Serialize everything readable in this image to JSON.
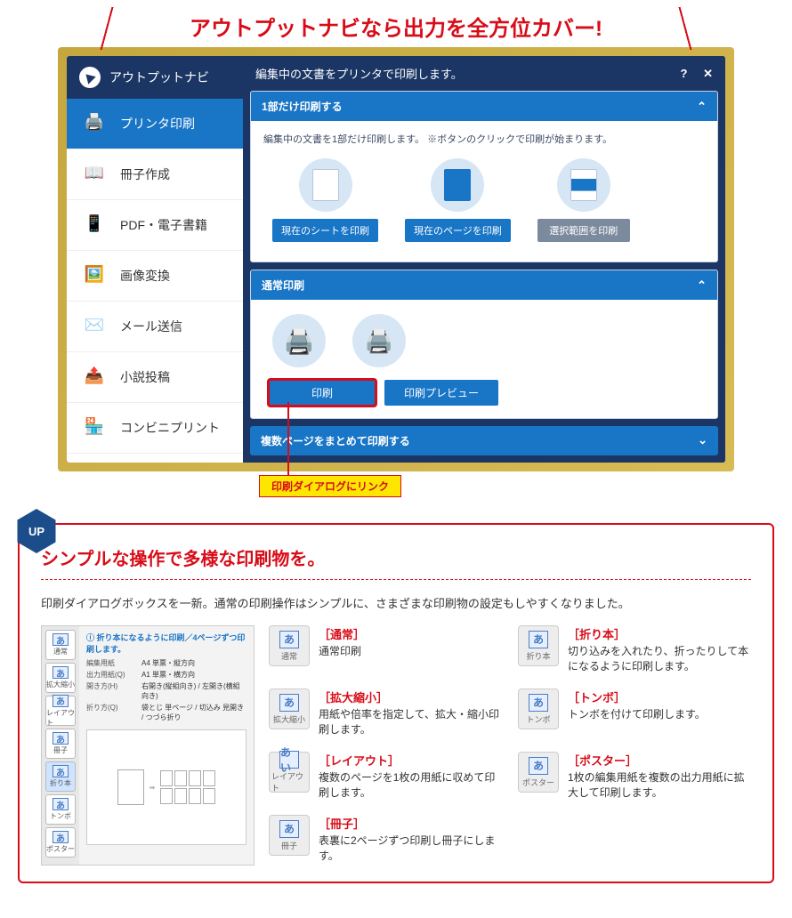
{
  "headline": "アウトプットナビなら出力を全方位カバー!",
  "navi_title": "アウトプットナビ",
  "main_header": "編集中の文書をプリンタで印刷します。",
  "help_icon": "?",
  "close_icon": "✕",
  "sidebar": {
    "items": [
      {
        "label": "プリンタ印刷",
        "icon": "🖨️"
      },
      {
        "label": "冊子作成",
        "icon": "📖"
      },
      {
        "label": "PDF・電子書籍",
        "icon": "📱"
      },
      {
        "label": "画像変換",
        "icon": "🖼️"
      },
      {
        "label": "メール送信",
        "icon": "✉️"
      },
      {
        "label": "小説投稿",
        "icon": "📤"
      },
      {
        "label": "コンビニプリント",
        "icon": "🏪"
      }
    ]
  },
  "card1": {
    "head": "1部だけ印刷する",
    "desc": "編集中の文書を1部だけ印刷します。 ※ボタンのクリックで印刷が始まります。",
    "btn1": "現在のシートを印刷",
    "btn2": "現在のページを印刷",
    "btn3": "選択範囲を印刷"
  },
  "card2": {
    "head": "通常印刷",
    "btn1": "印刷",
    "btn2": "印刷プレビュー"
  },
  "card3_head": "複数ページをまとめて印刷する",
  "callout": "印刷ダイアログにリンク",
  "info": {
    "badge": "UP",
    "title": "シンプルな操作で多様な印刷物を。",
    "desc": "印刷ダイアログボックスを一新。通常の印刷操作はシンプルに、さまざまな印刷物の設定もしやすくなりました。"
  },
  "dialog": {
    "header": "折り本になるように印刷／4ページずつ印刷します。",
    "side": [
      "通常",
      "拡大縮小",
      "レイアウト",
      "冊子",
      "折り本",
      "トンボ",
      "ポスター"
    ],
    "rows": [
      {
        "k": "編集用紙",
        "v": "A4 単票・縦方向"
      },
      {
        "k": "出力用紙(Q)",
        "v": "A1 単票・横方向"
      },
      {
        "k": "開き方(H)",
        "v": "右開き(縦組向き) / 左開き(横組向き)"
      },
      {
        "k": "折り方(Q)",
        "v": "袋とじ 単ページ / 切込み 見開き / つづら折り"
      }
    ]
  },
  "features_left": [
    {
      "icon": "通常",
      "glyph": "あ",
      "title": "［通常］",
      "desc": "通常印刷"
    },
    {
      "icon": "拡大縮小",
      "glyph": "あ",
      "title": "［拡大縮小］",
      "desc": "用紙や倍率を指定して、拡大・縮小印刷します。"
    },
    {
      "icon": "レイアウト",
      "glyph": "あい",
      "title": "［レイアウト］",
      "desc": "複数のページを1枚の用紙に収めて印刷します。"
    },
    {
      "icon": "冊子",
      "glyph": "あ",
      "title": "［冊子］",
      "desc": "表裏に2ページずつ印刷し冊子にします。"
    }
  ],
  "features_right": [
    {
      "icon": "折り本",
      "glyph": "あ",
      "title": "［折り本］",
      "desc": "切り込みを入れたり、折ったりして本になるように印刷します。"
    },
    {
      "icon": "トンボ",
      "glyph": "あ",
      "title": "［トンボ］",
      "desc": "トンボを付けて印刷します。"
    },
    {
      "icon": "ポスター",
      "glyph": "あ",
      "title": "［ポスター］",
      "desc": "1枚の編集用紙を複数の出力用紙に拡大して印刷します。"
    }
  ]
}
